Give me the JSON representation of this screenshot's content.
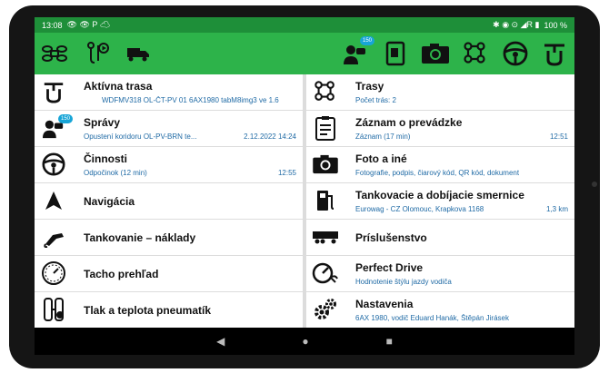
{
  "status_bar": {
    "time": "13:08",
    "battery": "100 %",
    "right_icons": "✱ ◉ ⊙ ◢R ▮"
  },
  "colors": {
    "toolbar": "#2db34a",
    "status_bar": "#1e8f39",
    "subtitle": "#1f6aa5",
    "badge": "#17a5d7"
  },
  "toolbar": {
    "left": [
      {
        "icon": "drone-icon"
      },
      {
        "icon": "route-play-icon"
      },
      {
        "icon": "truck-icon"
      }
    ],
    "right": [
      {
        "icon": "messages-icon",
        "badge": "150"
      },
      {
        "icon": "document-icon"
      },
      {
        "icon": "camera-icon"
      },
      {
        "icon": "routes-icon"
      },
      {
        "icon": "steering-wheel-icon"
      },
      {
        "icon": "tacho-logo-icon"
      }
    ]
  },
  "left_menu": [
    {
      "icon": "tacho-logo-icon",
      "title": "Aktívna trasa",
      "sub": "WDFMV318 OL-ČT-PV 01 6AX1980 tabM8img3 ve 1.6",
      "sub_right": ""
    },
    {
      "icon": "messages-icon",
      "badge": "150",
      "title": "Správy",
      "sub": "Opustení koridoru OL-PV-BRN te...",
      "sub_right": "2.12.2022 14:24"
    },
    {
      "icon": "steering-wheel-icon",
      "title": "Činnosti",
      "sub": "Odpočinok (12 min)",
      "sub_right": "12:55"
    },
    {
      "icon": "navigation-arrow-icon",
      "title": "Navigácia",
      "sub": "",
      "sub_right": ""
    },
    {
      "icon": "fuel-nozzle-icon",
      "title": "Tankovanie – náklady",
      "sub": "",
      "sub_right": ""
    },
    {
      "icon": "tachograph-gauge-icon",
      "title": "Tacho prehľad",
      "sub": "",
      "sub_right": ""
    },
    {
      "icon": "tire-pressure-icon",
      "title": "Tlak a teplota pneumatík",
      "sub": "",
      "sub_right": ""
    }
  ],
  "right_menu": [
    {
      "icon": "routes-icon",
      "title": "Trasy",
      "sub": "Počet trás: 2",
      "sub_right": ""
    },
    {
      "icon": "clipboard-icon",
      "title": "Záznam o prevádzke",
      "sub": "Záznam (17 min)",
      "sub_right": "12:51"
    },
    {
      "icon": "camera-icon",
      "title": "Foto a iné",
      "sub": "Fotografie, podpis, čiarový kód, QR kód, dokument",
      "sub_right": ""
    },
    {
      "icon": "fuel-pump-icon",
      "title": "Tankovacie a dobíjacie smernice",
      "sub": "Eurowag - CZ Olomouc, Krapkova 1168",
      "sub_right": "1,3 km"
    },
    {
      "icon": "trailer-icon",
      "title": "Príslušenstvo",
      "sub": "",
      "sub_right": ""
    },
    {
      "icon": "perfect-drive-icon",
      "title": "Perfect Drive",
      "sub": "Hodnotenie štýlu jazdy vodiča",
      "sub_right": ""
    },
    {
      "icon": "settings-gears-icon",
      "title": "Nastavenia",
      "sub": "6AX 1980, vodič Eduard Hanák, Štěpán Jirásek",
      "sub_right": ""
    }
  ],
  "nav_bar": {
    "back": "◀",
    "home": "●",
    "recents": "■"
  }
}
